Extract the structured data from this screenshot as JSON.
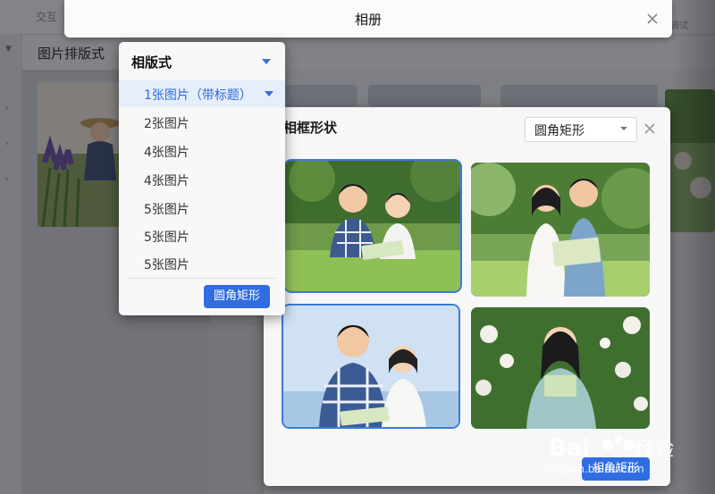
{
  "background": {
    "tab_label": "交互",
    "tab_right_label": "调试",
    "section_title": "图片排版式"
  },
  "album_dialog": {
    "title": "相册"
  },
  "layout_menu": {
    "header": "相版式",
    "items": [
      {
        "label": "1张图片（带标题）",
        "selected": true
      },
      {
        "label": "2张图片",
        "selected": false
      },
      {
        "label": "4张图片",
        "selected": false
      },
      {
        "label": "4张图片",
        "selected": false
      },
      {
        "label": "5张图片",
        "selected": false
      },
      {
        "label": "5张图片",
        "selected": false
      },
      {
        "label": "5张图片",
        "selected": false
      }
    ],
    "apply_label": "圆角矩形"
  },
  "frame_panel": {
    "title": "相框形状",
    "shape_value": "圆角矩形",
    "apply_label": "相角矩形",
    "photos": [
      {
        "name": "boy-girl-reading-in-grass",
        "selected": true
      },
      {
        "name": "girl-boy-reading-under-trees",
        "selected": false
      },
      {
        "name": "boy-girl-holding-book-sky",
        "selected": true
      },
      {
        "name": "girl-with-card-in-flowers",
        "selected": false
      }
    ]
  },
  "watermark": {
    "logo_text": "Bai 经验",
    "url": "jingyan.baidu.com"
  },
  "colors": {
    "accent": "#2f6de0",
    "selected_border": "#3a7bd5",
    "active_item_bg": "#e6eefb"
  }
}
